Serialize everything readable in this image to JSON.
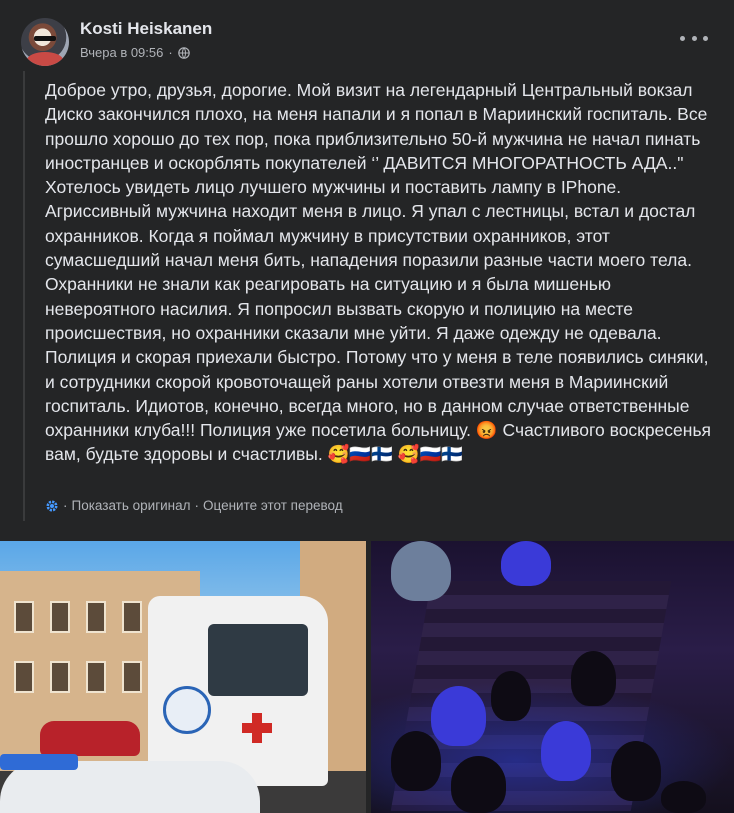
{
  "post": {
    "author": "Kosti Heiskanen",
    "timestamp": "Вчера в 09:56",
    "separator": "·",
    "text": "Доброе утро, друзья, дорогие. Мой визит на легендарный Центральный вокзал Диско закончился плохо, на меня напали и я попал в Мариинский госпиталь. Все прошло хорошо до тех пор, пока приблизительно 50-й мужчина не начал пинать иностранцев и оскорблять покупателей ‘’ ДАВИТСЯ МНОГОРАТНОСТЬ АДА..\" Хотелось увидеть лицо лучшего мужчины и поставить лампу в IPhone. Агриссивный мужчина находит меня в лицо. Я упал с лестницы, встал и достал охранников. Когда я поймал мужчину в присутствии охранников, этот сумасшедший начал меня бить, нападения поразили разные части моего тела. Охранники не знали как реагировать на ситуацию и я была мишенью невероятного насилия. Я попросил вызвать скорую и полицию на месте происшествия, но охранники сказали мне уйти. Я даже одежду не одевала. Полиция и скорая приехали быстро. Потому что у меня в теле появились синяки, и сотрудники скорой кровоточащей раны хотели отвезти меня в Мариинский госпиталь. Идиотов, конечно, всегда много, но в данном случае ответственные охранники клуба!!! Полиция уже посетила больницу. 😡 Счастливого воскресенья вам, будьте здоровы и счастливы. 🥰🇷🇺🇫🇮 🥰🇷🇺🇫🇮"
  },
  "translation": {
    "show_original": "Показать оригинал",
    "rate_translation": "Оцените этот перевод",
    "separator": "·"
  },
  "icons": {
    "globe": "globe-icon",
    "more": "more-options-icon",
    "gear": "gear-icon"
  },
  "colors": {
    "background": "#242526",
    "primary_text": "#e4e6eb",
    "secondary_text": "#b0b3b8"
  }
}
